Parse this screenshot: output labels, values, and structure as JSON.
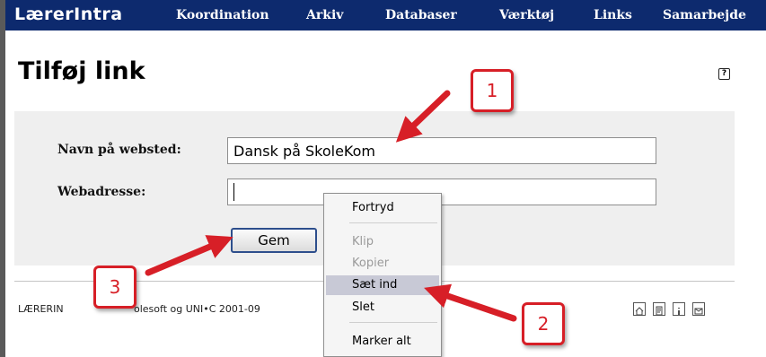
{
  "brand": "LærerIntra",
  "nav": [
    "Koordination",
    "Arkiv",
    "Databaser",
    "Værktøj",
    "Links",
    "Samarbejde"
  ],
  "page_title": "Tilføj link",
  "help_icon": "?",
  "form": {
    "name_label": "Navn på websted:",
    "name_value": "Dansk på SkoleKom",
    "url_label": "Webadresse:",
    "url_value": "",
    "save_label": "Gem"
  },
  "footer": {
    "text_left": "LÆRERIN",
    "text_right": "olesoft og UNI•C 2001-09",
    "icons": [
      "home-icon",
      "document-icon",
      "info-icon",
      "mail-icon"
    ]
  },
  "context_menu": {
    "items": [
      {
        "label": "Fortryd",
        "state": "enabled"
      },
      {
        "label": "Klip",
        "state": "disabled"
      },
      {
        "label": "Kopier",
        "state": "disabled"
      },
      {
        "label": "Sæt ind",
        "state": "highlighted"
      },
      {
        "label": "Slet",
        "state": "enabled"
      },
      {
        "label": "Marker alt",
        "state": "enabled"
      }
    ]
  },
  "callouts": [
    "1",
    "2",
    "3"
  ],
  "colors": {
    "nav_bg": "#0d2a6e",
    "callout_red": "#d71f27",
    "panel_bg": "#efefef"
  }
}
